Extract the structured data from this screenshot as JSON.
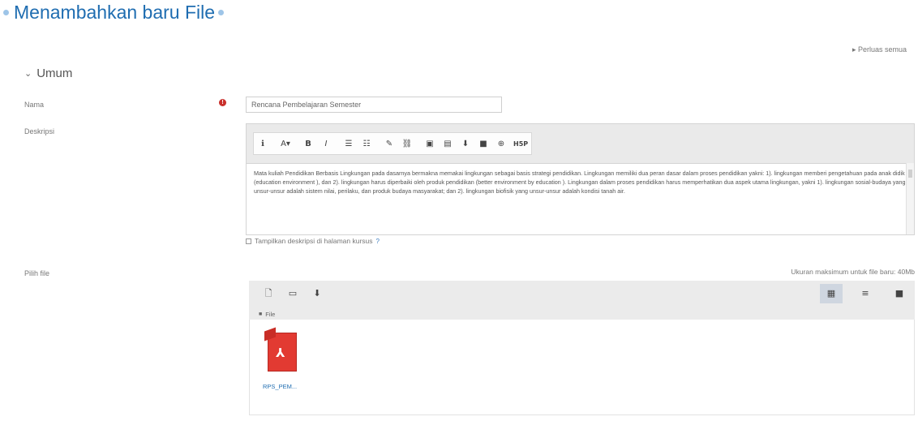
{
  "page": {
    "title": "Menambahkan baru File",
    "expand_all": "▸ Perluas semua"
  },
  "section": {
    "title": "Umum",
    "chevron_glyph": "⌄"
  },
  "fields": {
    "name_label": "Nama",
    "name_value": "Rencana Pembelajaran Semester",
    "description_label": "Deskripsi",
    "files_label": "Pilih file",
    "required_glyph": "!"
  },
  "editor": {
    "toolbar_glyphs": [
      "ℹ",
      "A▾",
      "B",
      "I",
      "☰",
      "☷",
      "✎",
      "⛓",
      "▣",
      "▤",
      "⬇",
      "■",
      "⊕",
      "H5P"
    ],
    "text": "Mata kuliah Pendidikan Berbasis Lingkungan pada dasarnya bermakna memakai lingkungan sebagai basis strategi pendidikan. Lingkungan memiliki dua peran dasar dalam proses pendidikan yakni: 1). lingkungan memberi pengetahuan pada anak didik (education environment ), dan 2). lingkungan harus diperbaiki oleh produk pendidikan (better environment by education ). Lingkungan dalam proses pendidikan harus memperhatikan dua aspek utama lingkungan, yakni 1). lingkungan sosial-budaya yang unsur-unsur adalah sistem nilai, perilaku, dan produk budaya masyarakat; dan 2). lingkungan biofisik yang unsur-unsur adalah kondisi tanah air."
  },
  "checkbox": {
    "label": "Tampilkan deskripsi di halaman kursus",
    "checked": false,
    "help_glyph": "?"
  },
  "filepicker": {
    "max_size_text": "Ukuran maksimum untuk file baru: 40Mb",
    "breadcrumb": "File",
    "folder_glyph": "■",
    "buttons": {
      "add_file": "🗋",
      "create_folder": "▭",
      "download": "⬇",
      "view_icons": "▦",
      "view_list": "≡",
      "view_tree": "■"
    },
    "files": [
      {
        "name": "RPS_PEM...",
        "type": "pdf",
        "logo_glyph": "⅄"
      }
    ]
  },
  "colors": {
    "title": "#1f6db1",
    "required": "#c9302c",
    "pdf": "#e23a32"
  }
}
